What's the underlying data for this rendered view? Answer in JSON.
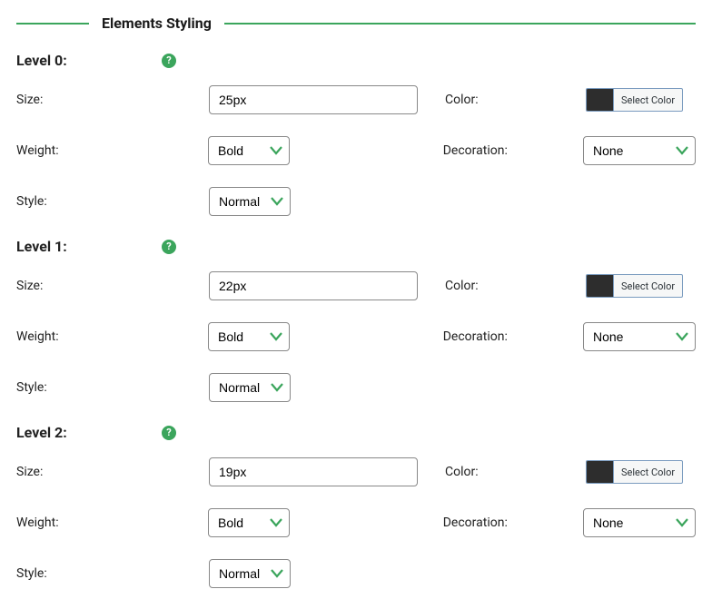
{
  "section_title": "Elements Styling",
  "labels": {
    "size": "Size:",
    "color": "Color:",
    "weight": "Weight:",
    "decoration": "Decoration:",
    "style": "Style:",
    "select_color": "Select Color"
  },
  "levels": [
    {
      "header": "Level 0:",
      "size": "25px",
      "weight": "Bold",
      "decoration": "None",
      "style": "Normal",
      "color_swatch": "#2d2d2d"
    },
    {
      "header": "Level 1:",
      "size": "22px",
      "weight": "Bold",
      "decoration": "None",
      "style": "Normal",
      "color_swatch": "#2d2d2d"
    },
    {
      "header": "Level 2:",
      "size": "19px",
      "weight": "Bold",
      "decoration": "None",
      "style": "Normal",
      "color_swatch": "#2d2d2d"
    }
  ]
}
